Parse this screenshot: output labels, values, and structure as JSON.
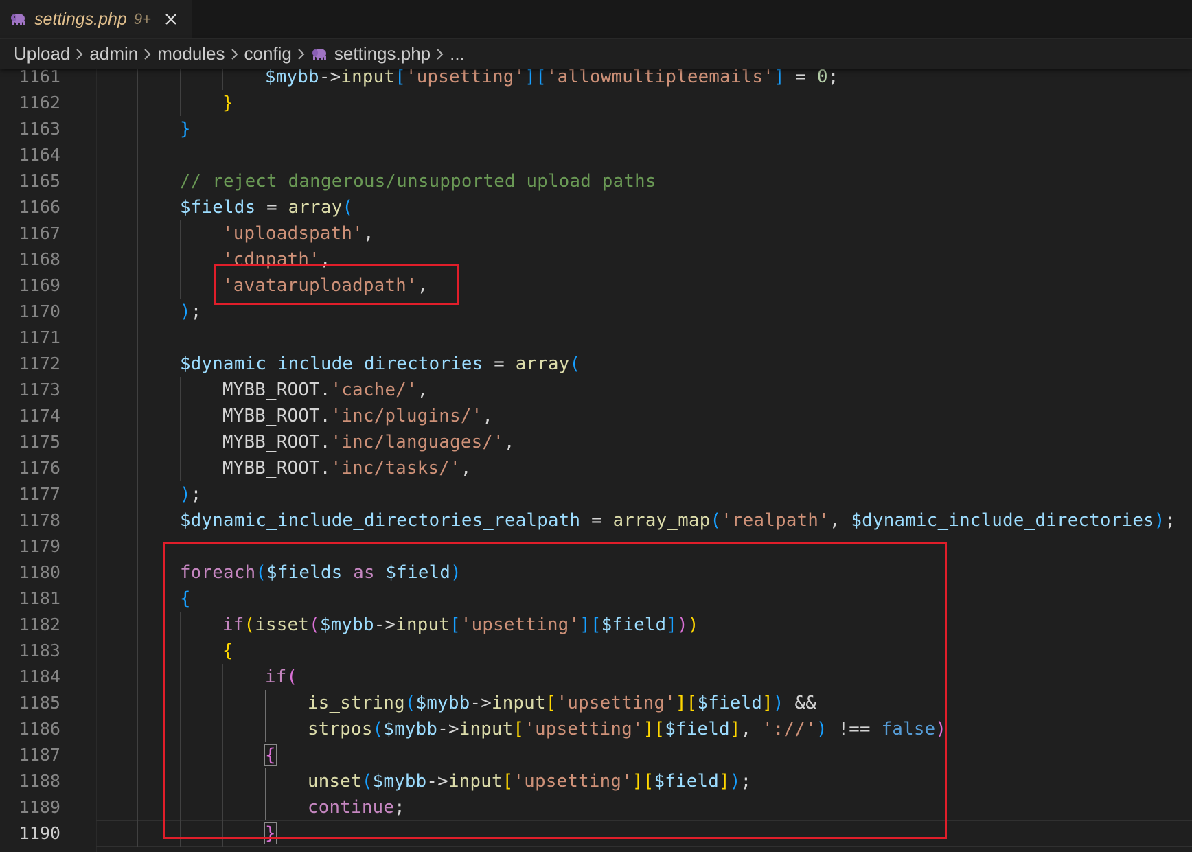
{
  "tab": {
    "filename": "settings.php",
    "badge": "9+",
    "close_icon": "close-icon",
    "file_icon": "php-elephant-icon"
  },
  "breadcrumb": {
    "items": [
      "Upload",
      "admin",
      "modules",
      "config",
      "settings.php",
      "..."
    ],
    "separator_icon": "chevron-right-icon"
  },
  "editor": {
    "active_line": "1190",
    "line_numbers": [
      "1161",
      "1162",
      "1163",
      "1164",
      "1165",
      "1166",
      "1167",
      "1168",
      "1169",
      "1170",
      "1171",
      "1172",
      "1173",
      "1174",
      "1175",
      "1176",
      "1177",
      "1178",
      "1179",
      "1180",
      "1181",
      "1182",
      "1183",
      "1184",
      "1185",
      "1186",
      "1187",
      "1188",
      "1189",
      "1190"
    ],
    "lines": [
      [
        [
          "var",
          "$mybb"
        ],
        [
          "op",
          "->"
        ],
        [
          "fn",
          "input"
        ],
        [
          "b3",
          "["
        ],
        [
          "str",
          "'upsetting'"
        ],
        [
          "b3",
          "]["
        ],
        [
          "str",
          "'allowmultipleemails'"
        ],
        [
          "b3",
          "]"
        ],
        [
          "op",
          " = "
        ],
        [
          "num",
          "0"
        ],
        [
          "op",
          ";"
        ]
      ],
      [
        [
          "b1",
          "}"
        ]
      ],
      [
        [
          "b3",
          "}"
        ]
      ],
      [],
      [
        [
          "cmt",
          "// reject dangerous/unsupported upload paths"
        ]
      ],
      [
        [
          "var",
          "$fields"
        ],
        [
          "op",
          " = "
        ],
        [
          "fn",
          "array"
        ],
        [
          "b3",
          "("
        ]
      ],
      [
        [
          "str",
          "'uploadspath'"
        ],
        [
          "op",
          ","
        ]
      ],
      [
        [
          "str",
          "'cdnpath'"
        ],
        [
          "op",
          ","
        ]
      ],
      [
        [
          "str",
          "'avataruploadpath'"
        ],
        [
          "op",
          ","
        ]
      ],
      [
        [
          "b3",
          ")"
        ],
        [
          "op",
          ";"
        ]
      ],
      [],
      [
        [
          "var",
          "$dynamic_include_directories"
        ],
        [
          "op",
          " = "
        ],
        [
          "fn",
          "array"
        ],
        [
          "b3",
          "("
        ]
      ],
      [
        [
          "const",
          "MYBB_ROOT"
        ],
        [
          "op",
          "."
        ],
        [
          "str",
          "'cache/'"
        ],
        [
          "op",
          ","
        ]
      ],
      [
        [
          "const",
          "MYBB_ROOT"
        ],
        [
          "op",
          "."
        ],
        [
          "str",
          "'inc/plugins/'"
        ],
        [
          "op",
          ","
        ]
      ],
      [
        [
          "const",
          "MYBB_ROOT"
        ],
        [
          "op",
          "."
        ],
        [
          "str",
          "'inc/languages/'"
        ],
        [
          "op",
          ","
        ]
      ],
      [
        [
          "const",
          "MYBB_ROOT"
        ],
        [
          "op",
          "."
        ],
        [
          "str",
          "'inc/tasks/'"
        ],
        [
          "op",
          ","
        ]
      ],
      [
        [
          "b3",
          ")"
        ],
        [
          "op",
          ";"
        ]
      ],
      [
        [
          "var",
          "$dynamic_include_directories_realpath"
        ],
        [
          "op",
          " = "
        ],
        [
          "fn",
          "array_map"
        ],
        [
          "b3",
          "("
        ],
        [
          "str",
          "'realpath'"
        ],
        [
          "op",
          ", "
        ],
        [
          "var",
          "$dynamic_include_directories"
        ],
        [
          "b3",
          ")"
        ],
        [
          "op",
          ";"
        ]
      ],
      [],
      [
        [
          "kw",
          "foreach"
        ],
        [
          "b3",
          "("
        ],
        [
          "var",
          "$fields"
        ],
        [
          "kw",
          " as "
        ],
        [
          "var",
          "$field"
        ],
        [
          "b3",
          ")"
        ]
      ],
      [
        [
          "b3",
          "{"
        ]
      ],
      [
        [
          "kw",
          "if"
        ],
        [
          "b1",
          "("
        ],
        [
          "fn",
          "isset"
        ],
        [
          "b2",
          "("
        ],
        [
          "var",
          "$mybb"
        ],
        [
          "op",
          "->"
        ],
        [
          "fn",
          "input"
        ],
        [
          "b3",
          "["
        ],
        [
          "str",
          "'upsetting'"
        ],
        [
          "b3",
          "]["
        ],
        [
          "var",
          "$field"
        ],
        [
          "b3",
          "]"
        ],
        [
          "b2",
          ")"
        ],
        [
          "b1",
          ")"
        ]
      ],
      [
        [
          "b1",
          "{"
        ]
      ],
      [
        [
          "kw",
          "if"
        ],
        [
          "b2",
          "("
        ]
      ],
      [
        [
          "fn",
          "is_string"
        ],
        [
          "b3",
          "("
        ],
        [
          "var",
          "$mybb"
        ],
        [
          "op",
          "->"
        ],
        [
          "fn",
          "input"
        ],
        [
          "b1",
          "["
        ],
        [
          "str",
          "'upsetting'"
        ],
        [
          "b1",
          "]["
        ],
        [
          "var",
          "$field"
        ],
        [
          "b1",
          "]"
        ],
        [
          "b3",
          ")"
        ],
        [
          "op",
          " &&"
        ]
      ],
      [
        [
          "fn",
          "strpos"
        ],
        [
          "b3",
          "("
        ],
        [
          "var",
          "$mybb"
        ],
        [
          "op",
          "->"
        ],
        [
          "fn",
          "input"
        ],
        [
          "b1",
          "["
        ],
        [
          "str",
          "'upsetting'"
        ],
        [
          "b1",
          "]["
        ],
        [
          "var",
          "$field"
        ],
        [
          "b1",
          "]"
        ],
        [
          "op",
          ", "
        ],
        [
          "str",
          "'://'"
        ],
        [
          "b3",
          ")"
        ],
        [
          "op",
          " !== "
        ],
        [
          "bool",
          "false"
        ],
        [
          "b2",
          ")"
        ]
      ],
      [
        [
          "b2m",
          "{"
        ]
      ],
      [
        [
          "fn",
          "unset"
        ],
        [
          "b3",
          "("
        ],
        [
          "var",
          "$mybb"
        ],
        [
          "op",
          "->"
        ],
        [
          "fn",
          "input"
        ],
        [
          "b1",
          "["
        ],
        [
          "str",
          "'upsetting'"
        ],
        [
          "b1",
          "]["
        ],
        [
          "var",
          "$field"
        ],
        [
          "b1",
          "]"
        ],
        [
          "b3",
          ")"
        ],
        [
          "op",
          ";"
        ]
      ],
      [
        [
          "kw",
          "continue"
        ],
        [
          "op",
          ";"
        ]
      ],
      [
        [
          "b2m",
          "}"
        ]
      ]
    ],
    "indents": [
      4,
      3,
      2,
      2,
      2,
      2,
      3,
      3,
      3,
      2,
      2,
      2,
      3,
      3,
      3,
      3,
      2,
      2,
      2,
      2,
      2,
      3,
      3,
      4,
      5,
      5,
      4,
      5,
      5,
      4
    ]
  },
  "highlights": {
    "color": "#e01e2a",
    "count": 2
  }
}
